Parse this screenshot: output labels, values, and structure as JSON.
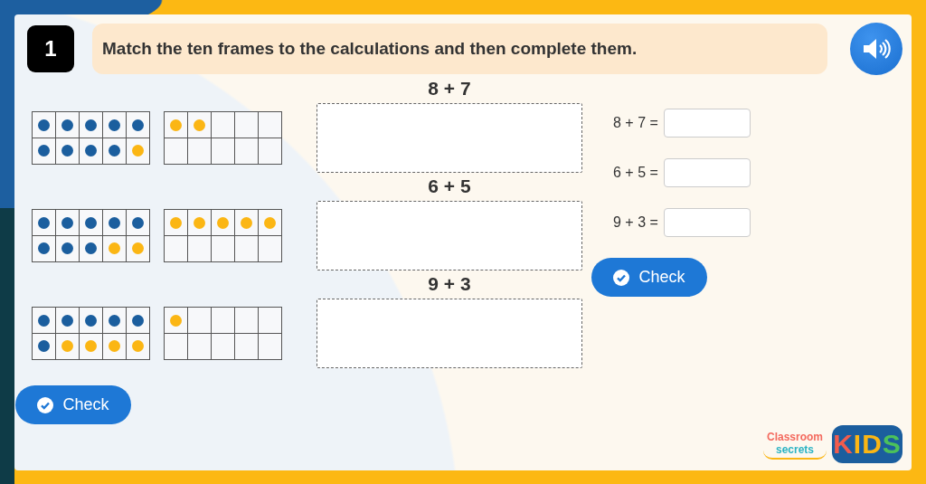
{
  "question": {
    "number": "1",
    "instruction": "Match the ten frames to the calculations and then complete them."
  },
  "ten_frame_pairs": [
    {
      "frames": [
        {
          "counters": [
            {
              "color": "#1b5e9e"
            },
            {
              "color": "#1b5e9e"
            },
            {
              "color": "#1b5e9e"
            },
            {
              "color": "#1b5e9e"
            },
            {
              "color": "#1b5e9e"
            },
            {
              "color": "#1b5e9e"
            },
            {
              "color": "#1b5e9e"
            },
            {
              "color": "#1b5e9e"
            },
            {
              "color": "#1b5e9e"
            },
            {
              "color": "#fbb614"
            }
          ]
        },
        {
          "counters": [
            {
              "color": "#fbb614"
            },
            {
              "color": "#fbb614"
            }
          ]
        }
      ]
    },
    {
      "frames": [
        {
          "counters": [
            {
              "color": "#1b5e9e"
            },
            {
              "color": "#1b5e9e"
            },
            {
              "color": "#1b5e9e"
            },
            {
              "color": "#1b5e9e"
            },
            {
              "color": "#1b5e9e"
            },
            {
              "color": "#1b5e9e"
            },
            {
              "color": "#1b5e9e"
            },
            {
              "color": "#1b5e9e"
            },
            {
              "color": "#fbb614"
            },
            {
              "color": "#fbb614"
            }
          ]
        },
        {
          "counters": [
            {
              "color": "#fbb614"
            },
            {
              "color": "#fbb614"
            },
            {
              "color": "#fbb614"
            },
            {
              "color": "#fbb614"
            },
            {
              "color": "#fbb614"
            }
          ]
        }
      ]
    },
    {
      "frames": [
        {
          "counters": [
            {
              "color": "#1b5e9e"
            },
            {
              "color": "#1b5e9e"
            },
            {
              "color": "#1b5e9e"
            },
            {
              "color": "#1b5e9e"
            },
            {
              "color": "#1b5e9e"
            },
            {
              "color": "#1b5e9e"
            },
            {
              "color": "#fbb614"
            },
            {
              "color": "#fbb614"
            },
            {
              "color": "#fbb614"
            },
            {
              "color": "#fbb614"
            }
          ]
        },
        {
          "counters": [
            {
              "color": "#fbb614"
            }
          ]
        }
      ]
    }
  ],
  "drop_zones": [
    {
      "label": "8 + 7"
    },
    {
      "label": "6 + 5"
    },
    {
      "label": "9 + 3"
    }
  ],
  "matching_check": {
    "label": "Check"
  },
  "equations": [
    {
      "text": "8 + 7 ="
    },
    {
      "text": "6 + 5 ="
    },
    {
      "text": "9 + 3 ="
    }
  ],
  "answers_check": {
    "label": "Check"
  },
  "logo": {
    "brand": "Classroom",
    "sub": "secrets",
    "kids": "KIDS"
  }
}
